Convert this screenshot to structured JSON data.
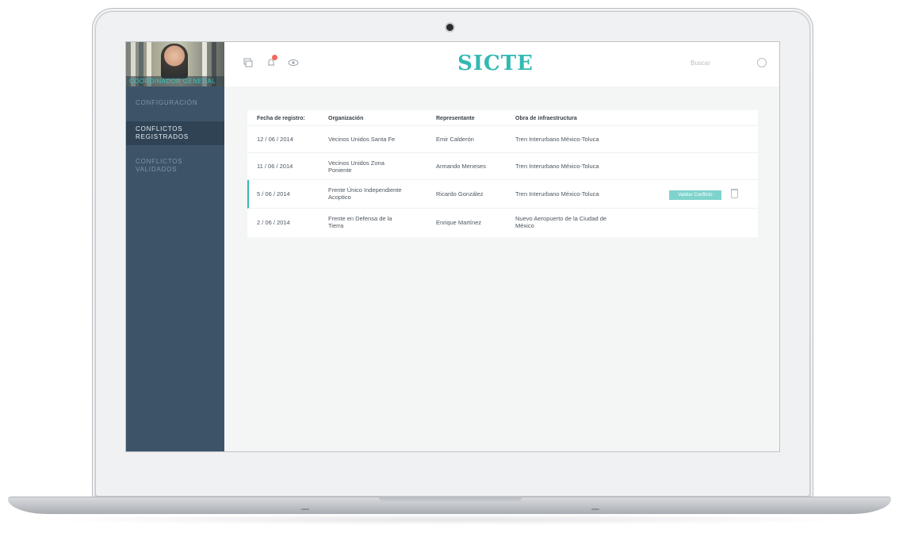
{
  "app": {
    "logo": "SICTE",
    "profile_name": "COORDINADOR GENERAL"
  },
  "sidebar": {
    "items": [
      {
        "label": "CONFIGURACIÓN",
        "active": false
      },
      {
        "label": "CONFLICTOS REGISTRADOS",
        "active": true
      },
      {
        "label": "CONFLICTOS VALIDADOS",
        "active": false
      }
    ]
  },
  "topbar": {
    "icons": [
      "chat-icon",
      "bell-icon",
      "eye-icon"
    ],
    "search_placeholder": "Buscar"
  },
  "table": {
    "headers": [
      "Fecha de registro:",
      "Organización",
      "Representante",
      "Obra de infraestructura"
    ],
    "rows": [
      {
        "fecha": "12 / 06 / 2014",
        "organizacion": "Vecinos Unidos Santa Fe",
        "representante": "Emir Calderón",
        "obra": "Tren Interurbano México-Toluca"
      },
      {
        "fecha": "11 / 06 / 2014",
        "organizacion": "Vecinos Unidos Zona Poniente",
        "representante": "Armando Meneses",
        "obra": "Tren Interurbano México-Toluca"
      },
      {
        "fecha": "5 / 06 / 2014",
        "organizacion": "Frente Único Independiente Acoptico",
        "representante": "Ricardo González",
        "obra": "Tren Interurbano México-Toluca",
        "action_label": "Validar Conflicto"
      },
      {
        "fecha": "2 / 06 / 2014",
        "organizacion": "Frente en Defensa de la Tierra",
        "representante": "Enrique Martínez",
        "obra": "Nuevo Aeropuerto de la Ciudad de México"
      }
    ]
  },
  "colors": {
    "accent": "#32b9b2",
    "sidebar": "#3d5468",
    "sidebar_active": "#2f4354",
    "badge": "#f26a5c"
  }
}
